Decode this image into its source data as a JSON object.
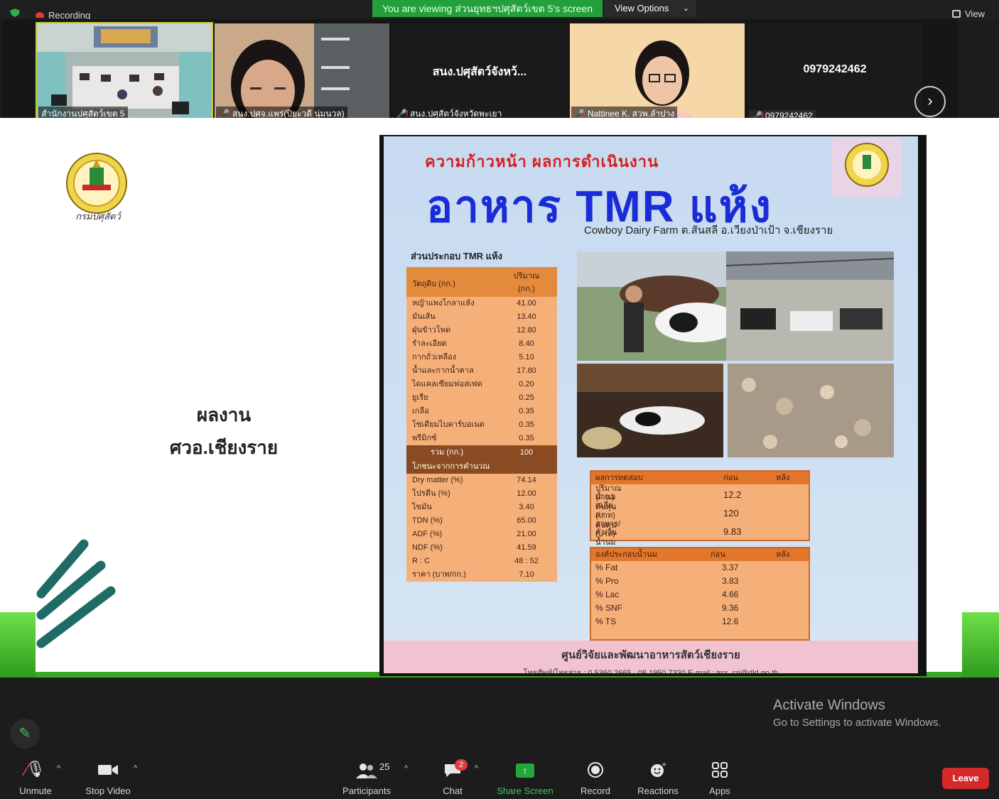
{
  "topbar": {
    "recording": "Recording",
    "viewing_banner": "You are viewing ส่วนยุทธฯปศุสัตว์เขต 5's screen",
    "view_options": "View Options",
    "view": "View"
  },
  "participants_strip": [
    {
      "name": "สำนักงานปศุสัตว์เขต 5",
      "type": "video",
      "muted": false
    },
    {
      "name": "สนง.ปศจ.แพร่(ปิยะวดี นุ่มนวล)",
      "type": "video",
      "muted": true
    },
    {
      "name": "สนง.ปศุสัตว์จังหวัดพะเยา",
      "type": "name",
      "display": "สนง.ปศุสัตว์จังหว้...",
      "muted": true
    },
    {
      "name": "Nattinee K. สวพ.ลำปาง",
      "type": "video",
      "muted": true
    },
    {
      "name": "0979242462",
      "type": "name",
      "display": "0979242462",
      "muted": true
    }
  ],
  "slide": {
    "logo_text": "กรมปศุสัตว์",
    "headline_1": "ผลงาน",
    "headline_2": "ศวอ.เชียงราย",
    "poster": {
      "subtitle": "ความก้าวหน้า ผลการดำเนินงาน",
      "title": "อาหาร TMR แห้ง",
      "farm": "Cowboy Dairy Farm ต.สันสลี อ.เวียงป่าเป้า จ.เชียงราย",
      "composition_label": "ส่วนประกอบ TMR แห้ง",
      "table_header": {
        "col1": "วัตถุดิบ (กก.)",
        "col2_a": "ปริมาณ",
        "col2_b": "(กก.)"
      },
      "ingredients": [
        {
          "name": "หญ้าแพงโกลาแห้ง",
          "value": "41.00"
        },
        {
          "name": "มันเส้น",
          "value": "13.40"
        },
        {
          "name": "ฝุ่นข้าวโพด",
          "value": "12.80"
        },
        {
          "name": "รำละเอียด",
          "value": "8.40"
        },
        {
          "name": "กากถั่วเหลือง",
          "value": "5.10"
        },
        {
          "name": "น้ำและกากน้ำตาล",
          "value": "17.80"
        },
        {
          "name": "ไดแคลเซียมฟอสเฟต",
          "value": "0.20"
        },
        {
          "name": "ยูเรีย",
          "value": "0.25"
        },
        {
          "name": "เกลือ",
          "value": "0.35"
        },
        {
          "name": "โซเดียมไบคาร์บอเนต",
          "value": "0.35"
        },
        {
          "name": "พรีมิกซ์",
          "value": "0.35"
        }
      ],
      "total": {
        "name": "รวม (กก.)",
        "value": "100"
      },
      "nutrition_label": "โภชนะจากการคำนวณ",
      "nutrition": [
        {
          "name": "Dry matter (%)",
          "value": "74.14"
        },
        {
          "name": "โปรตีน (%)",
          "value": "12.00"
        },
        {
          "name": "ไขมัน",
          "value": "3.40"
        },
        {
          "name": "TDN (%)",
          "value": "65.00"
        },
        {
          "name": "ADF (%)",
          "value": "21.00"
        },
        {
          "name": "NDF (%)",
          "value": "41.59"
        },
        {
          "name": "R : C",
          "value": "48 : 52"
        },
        {
          "name": "ราคา (บาท/กก.)",
          "value": "7.10"
        }
      ],
      "results": {
        "header": {
          "c1": "ผลการทดสอบ",
          "c2": "ก่อน",
          "c3": "หลัง"
        },
        "rows": [
          {
            "label_1": "ปริมาณน้ำนมเฉลี่ย",
            "label_2": "(ก.ก.)",
            "before": "12.2"
          },
          {
            "label_1": "ต้นทุนค่าอาหาร/ตัว/วัน",
            "label_2": "(บาท)",
            "before": "120"
          },
          {
            "label_1": "ต้นทุน : น้ำนม 1 กก",
            "label_2": "(บาท)",
            "before": "9.83"
          }
        ]
      },
      "milk": {
        "header": {
          "c1": "องค์ประกอบน้ำนม",
          "c2": "ก่อน",
          "c3": "หลัง"
        },
        "rows": [
          {
            "label": "% Fat",
            "before": "3.37"
          },
          {
            "label": "% Pro",
            "before": "3.83"
          },
          {
            "label": "% Lac",
            "before": "4.66"
          },
          {
            "label": "% SNF",
            "before": "9.36"
          },
          {
            "label": "% TS",
            "before": "12.6"
          }
        ]
      },
      "footer_1": "ศูนย์วิจัยและพัฒนาอาหารสัตว์เชียงราย",
      "footer_2": "โทรศัพท์/โทรสาร : 0 5360 2665 , 08 1950 7330 E-mail : trcr_cri@dld.go.th"
    }
  },
  "watermark": {
    "line1": "Activate Windows",
    "line2": "Go to Settings to activate Windows."
  },
  "toolbar": {
    "unmute": "Unmute",
    "stop_video": "Stop Video",
    "participants": "Participants",
    "participants_count": "25",
    "chat": "Chat",
    "chat_badge": "2",
    "share_screen": "Share Screen",
    "record": "Record",
    "reactions": "Reactions",
    "apps": "Apps",
    "leave": "Leave"
  }
}
